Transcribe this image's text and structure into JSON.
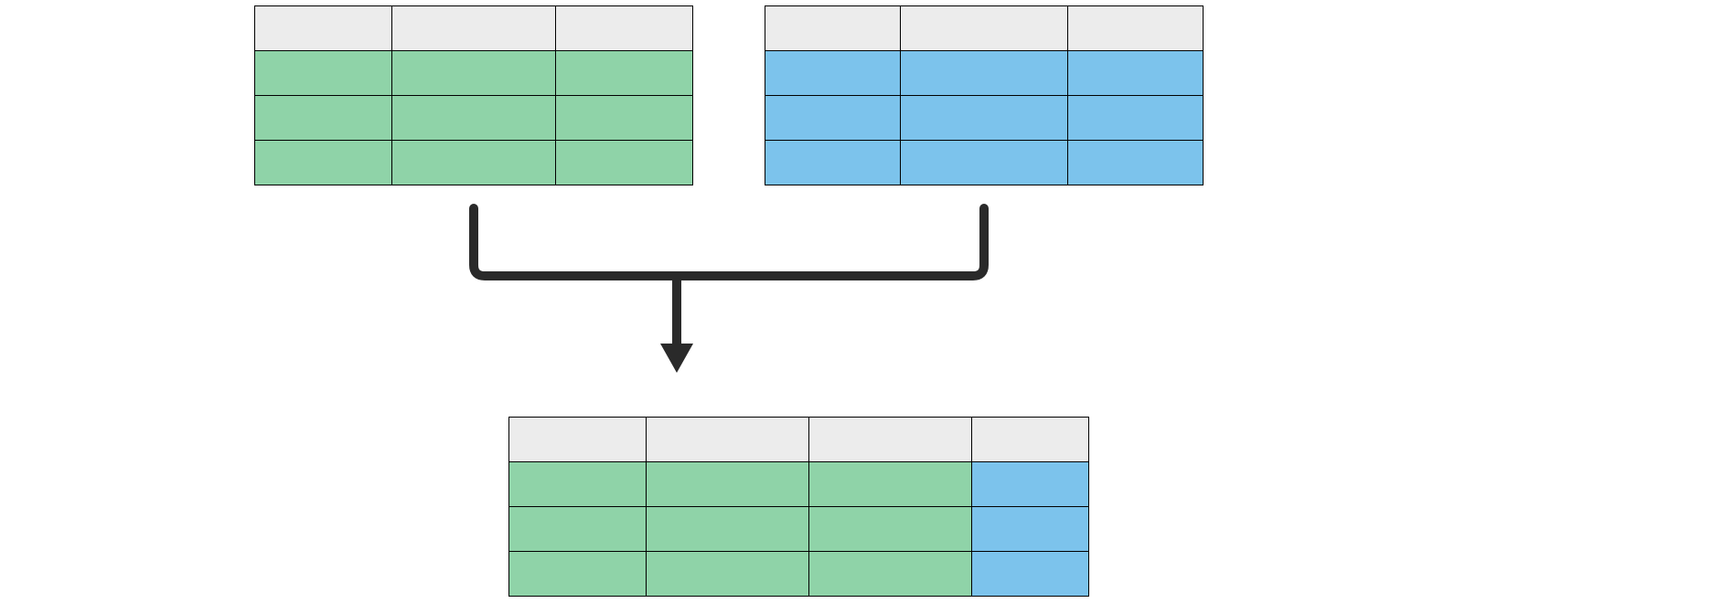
{
  "colors": {
    "header": "#ececec",
    "green": "#8fd3a8",
    "blue": "#7cc3ec",
    "border": "#000000",
    "arrow": "#2a2a2a"
  },
  "left_table": {
    "cols": 3,
    "rows": 4,
    "row_colors": [
      "header",
      "green",
      "green",
      "green"
    ]
  },
  "right_table": {
    "cols": 3,
    "rows": 4,
    "row_colors": [
      "header",
      "blue",
      "blue",
      "blue"
    ]
  },
  "merged_table": {
    "cols": 4,
    "rows": 4,
    "cell_colors": [
      [
        "header",
        "header",
        "header",
        "header"
      ],
      [
        "green",
        "green",
        "green",
        "blue"
      ],
      [
        "green",
        "green",
        "green",
        "blue"
      ],
      [
        "green",
        "green",
        "green",
        "blue"
      ]
    ]
  }
}
